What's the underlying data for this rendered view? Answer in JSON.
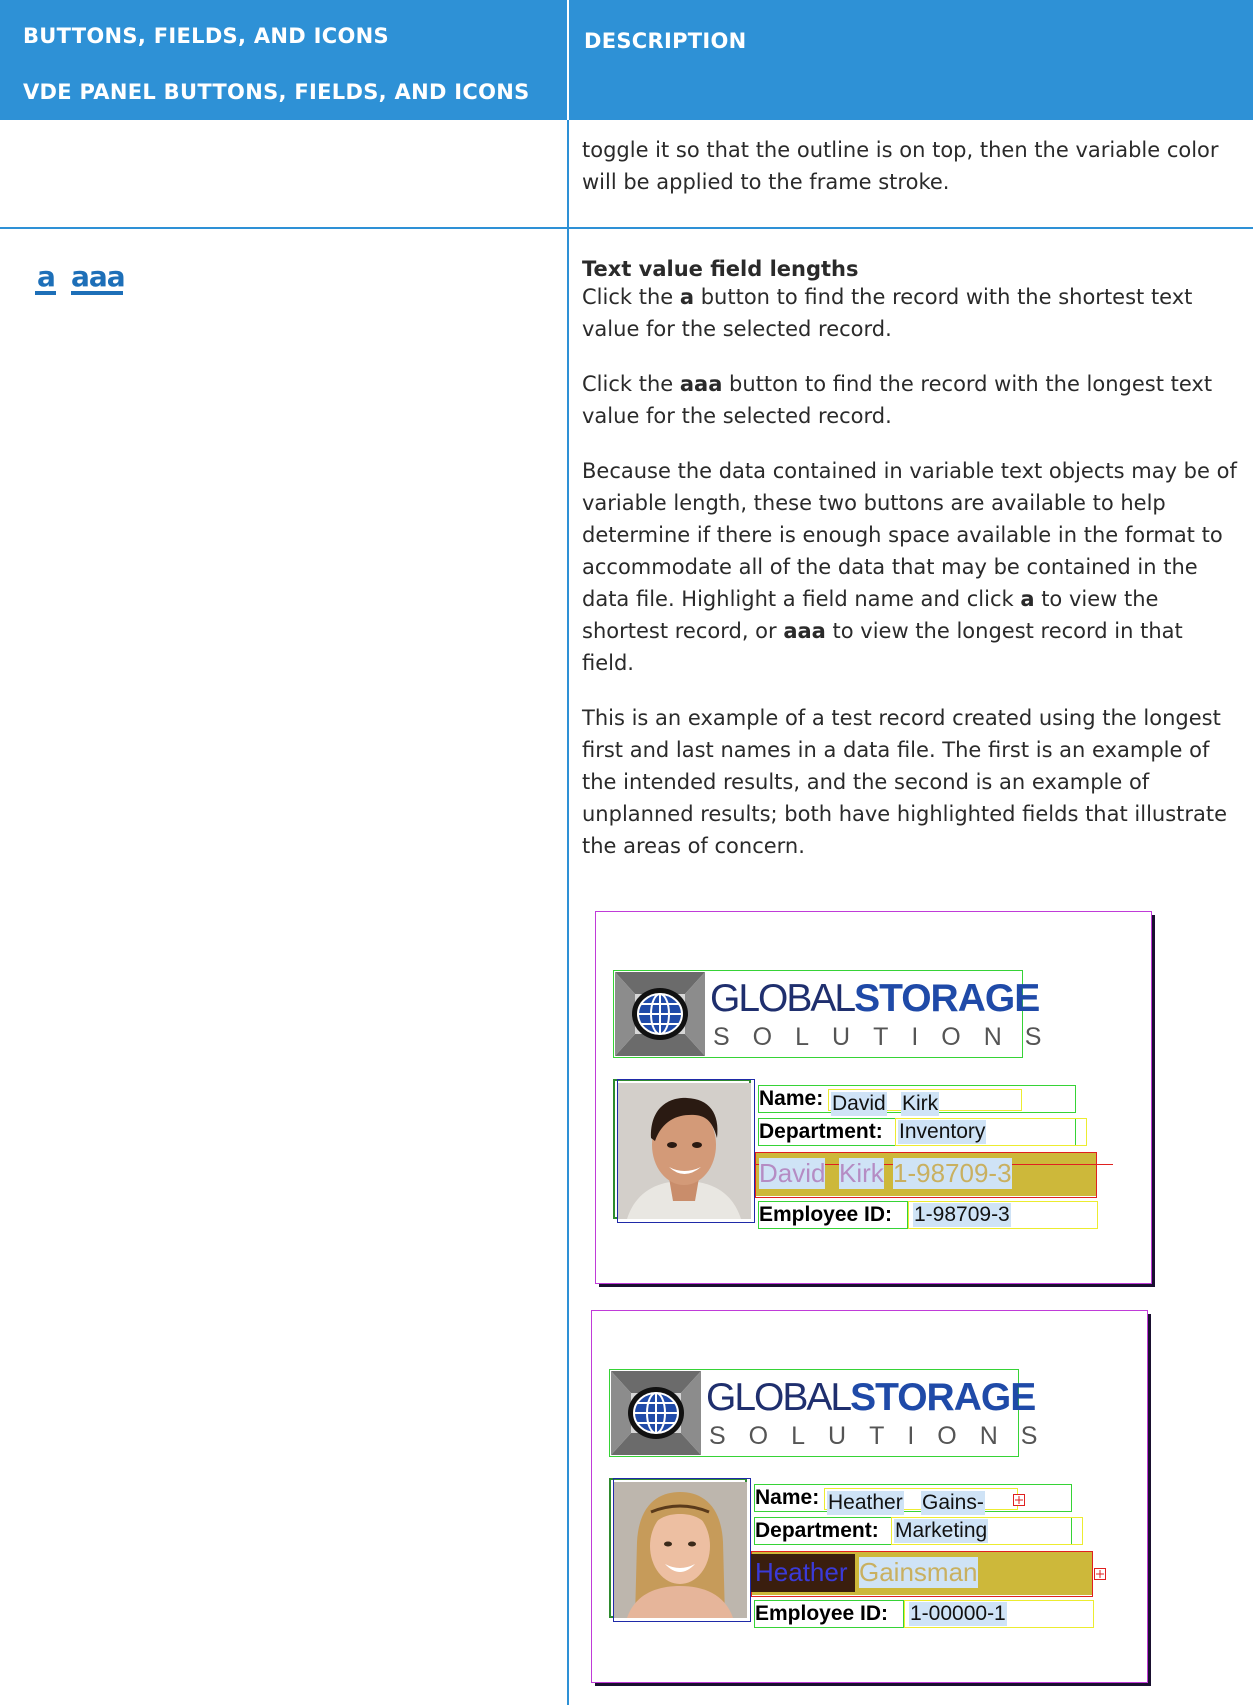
{
  "header": {
    "col1_line1": "BUTTONS, FIELDS, AND ICONS",
    "col1_line2": "VDE PANEL BUTTONS, FIELDS, AND ICONS",
    "col2": "DESCRIPTION"
  },
  "row1": {
    "text": "toggle it so that the outline is on top, then the variable color will be applied to the frame stroke."
  },
  "row2": {
    "icon_short": "a",
    "icon_long": "aaa",
    "heading": "Text value field lengths",
    "p1_pre": "Click the ",
    "p1_bold": "a",
    "p1_post": " button to find the record with the shortest text value for the selected record.",
    "p2_pre": "Click the ",
    "p2_bold": "aaa",
    "p2_post": " button to find the record with the longest text value for the selected record.",
    "p3_a": "Because the data contained in variable text objects may be of variable length, these two buttons are available to help determine if there is enough space available in the format to accommodate all of the data that may be contained in the data file. Highlight a field name and click ",
    "p3_b": "a",
    "p3_c": " to view the shortest record, or ",
    "p3_d": "aaa",
    "p3_e": " to view the longest record in that field.",
    "p4": "This is an example of a test record created using the longest first and last names in a data file. The first is an example of the intended results, and the second is an example of unplanned results; both have highlighted fields that illustrate the areas of concern."
  },
  "logo": {
    "word1": "GLOBAL",
    "word2": "STORAGE",
    "word3": "SOLUTIONS"
  },
  "card1": {
    "name_label": "Name:",
    "first": "David",
    "last": "Kirk",
    "dept_label": "Department:",
    "dept": "Inventory",
    "big_first": "David",
    "big_last": "Kirk",
    "big_id": "1-98709-3",
    "id_label": "Employee ID:",
    "id": "1-98709-3"
  },
  "card2": {
    "name_label": "Name:",
    "first": "Heather",
    "last": "Gains-",
    "dept_label": "Department:",
    "dept": "Marketing",
    "big_first": "Heather",
    "big_last": "Gainsman",
    "id_label": "Employee ID:",
    "id": "1-00000-1"
  },
  "colors": {
    "header_blue": "#2e91d6",
    "frame_magenta": "#c03bd8",
    "frame_green": "#36d336",
    "frame_yellow": "#ecec30",
    "frame_red": "#e02020",
    "highlight_blue": "#cfe3f6",
    "mustard": "#cdb83a"
  }
}
